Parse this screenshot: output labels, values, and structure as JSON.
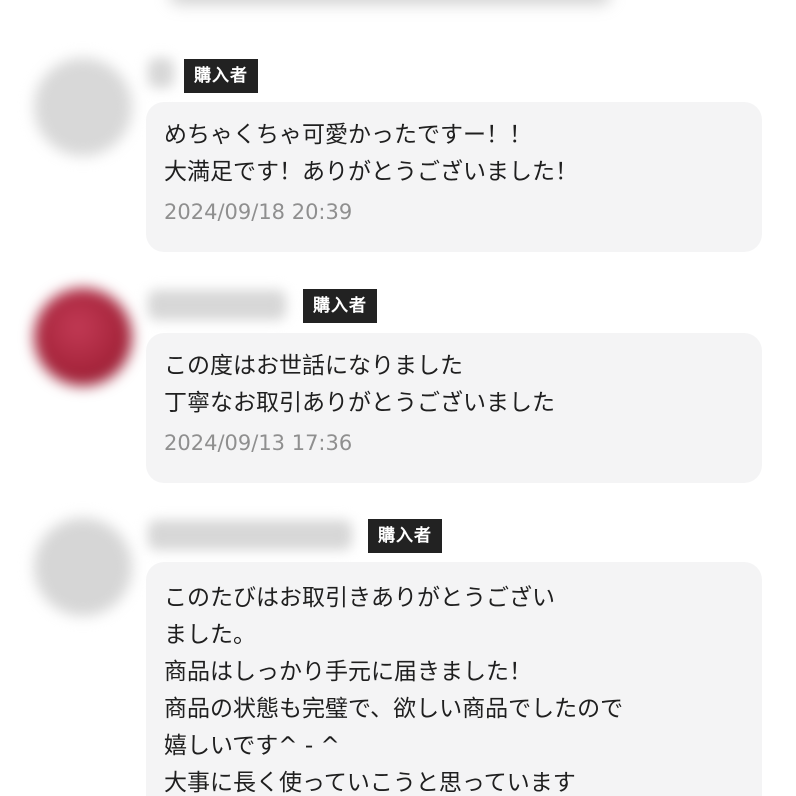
{
  "reviews": [
    {
      "badge": "購入者",
      "lines": [
        "めちゃくちゃ可愛かったですー！！",
        "大満足です！ありがとうございました！"
      ],
      "timestamp": "2024/09/18 20:39"
    },
    {
      "badge": "購入者",
      "lines": [
        "この度はお世話になりました",
        "丁寧なお取引ありがとうございました"
      ],
      "timestamp": "2024/09/13 17:36"
    },
    {
      "badge": "購入者",
      "lines": [
        "このたびはお取引きありがとうござい",
        "ました。",
        "商品はしっかり手元に届きました！",
        "商品の状態も完璧で、欲しい商品でしたので",
        "嬉しいです^ - ^",
        "大事に長く使っていこうと思っています"
      ]
    }
  ],
  "colors": {
    "badge_bg": "#222222",
    "bubble_bg": "#f4f4f5",
    "timestamp": "#8f8f8f",
    "avatar_2": "#a7253c"
  }
}
